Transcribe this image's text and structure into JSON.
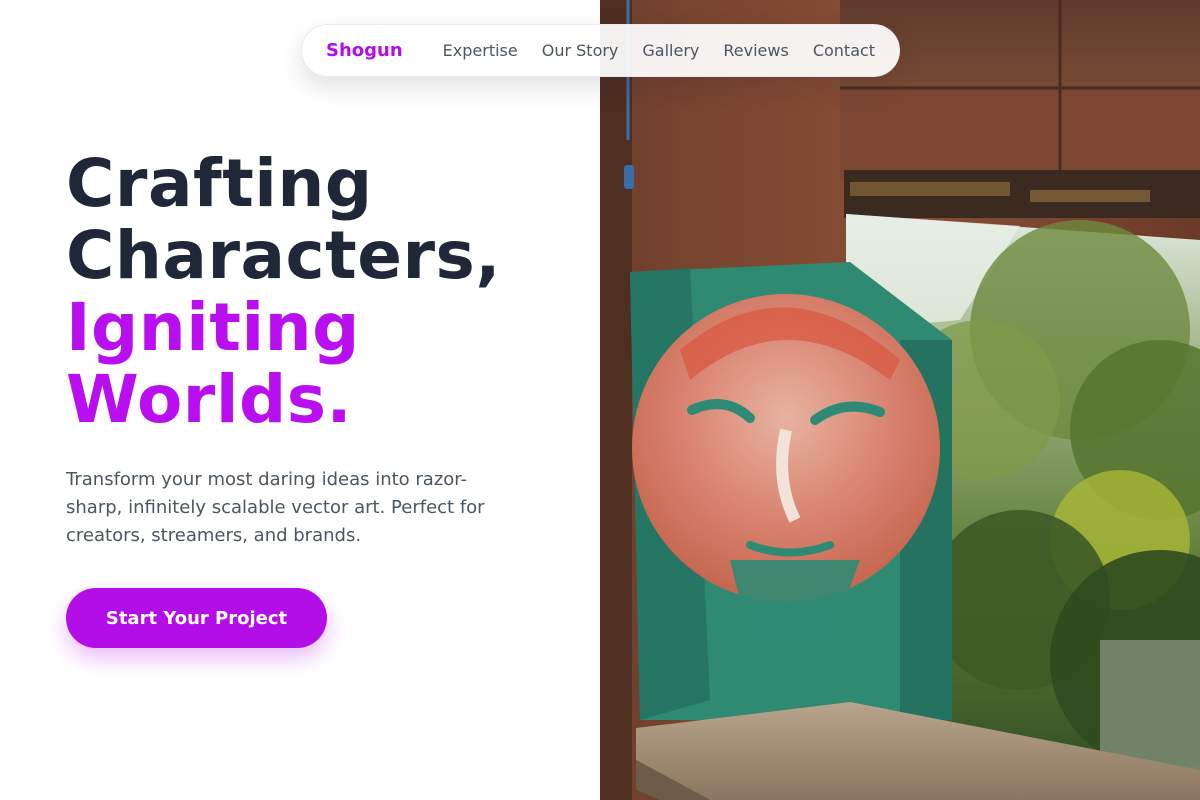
{
  "nav": {
    "brand": "Shogun",
    "links": [
      {
        "label": "Expertise"
      },
      {
        "label": "Our Story"
      },
      {
        "label": "Gallery"
      },
      {
        "label": "Reviews"
      },
      {
        "label": "Contact"
      }
    ]
  },
  "hero": {
    "headline_lines": [
      "Crafting",
      "Characters,"
    ],
    "headline_accent_lines": [
      "Igniting",
      "Worlds."
    ],
    "subtext": "Transform your most daring ideas into razor-sharp, infinitely scalable vector art. Perfect for creators, streamers, and brands.",
    "cta_label": "Start Your Project"
  },
  "colors": {
    "brand_accent": "#b40ee8",
    "headline_dark": "#1f2738",
    "body_text": "#4b5563"
  }
}
